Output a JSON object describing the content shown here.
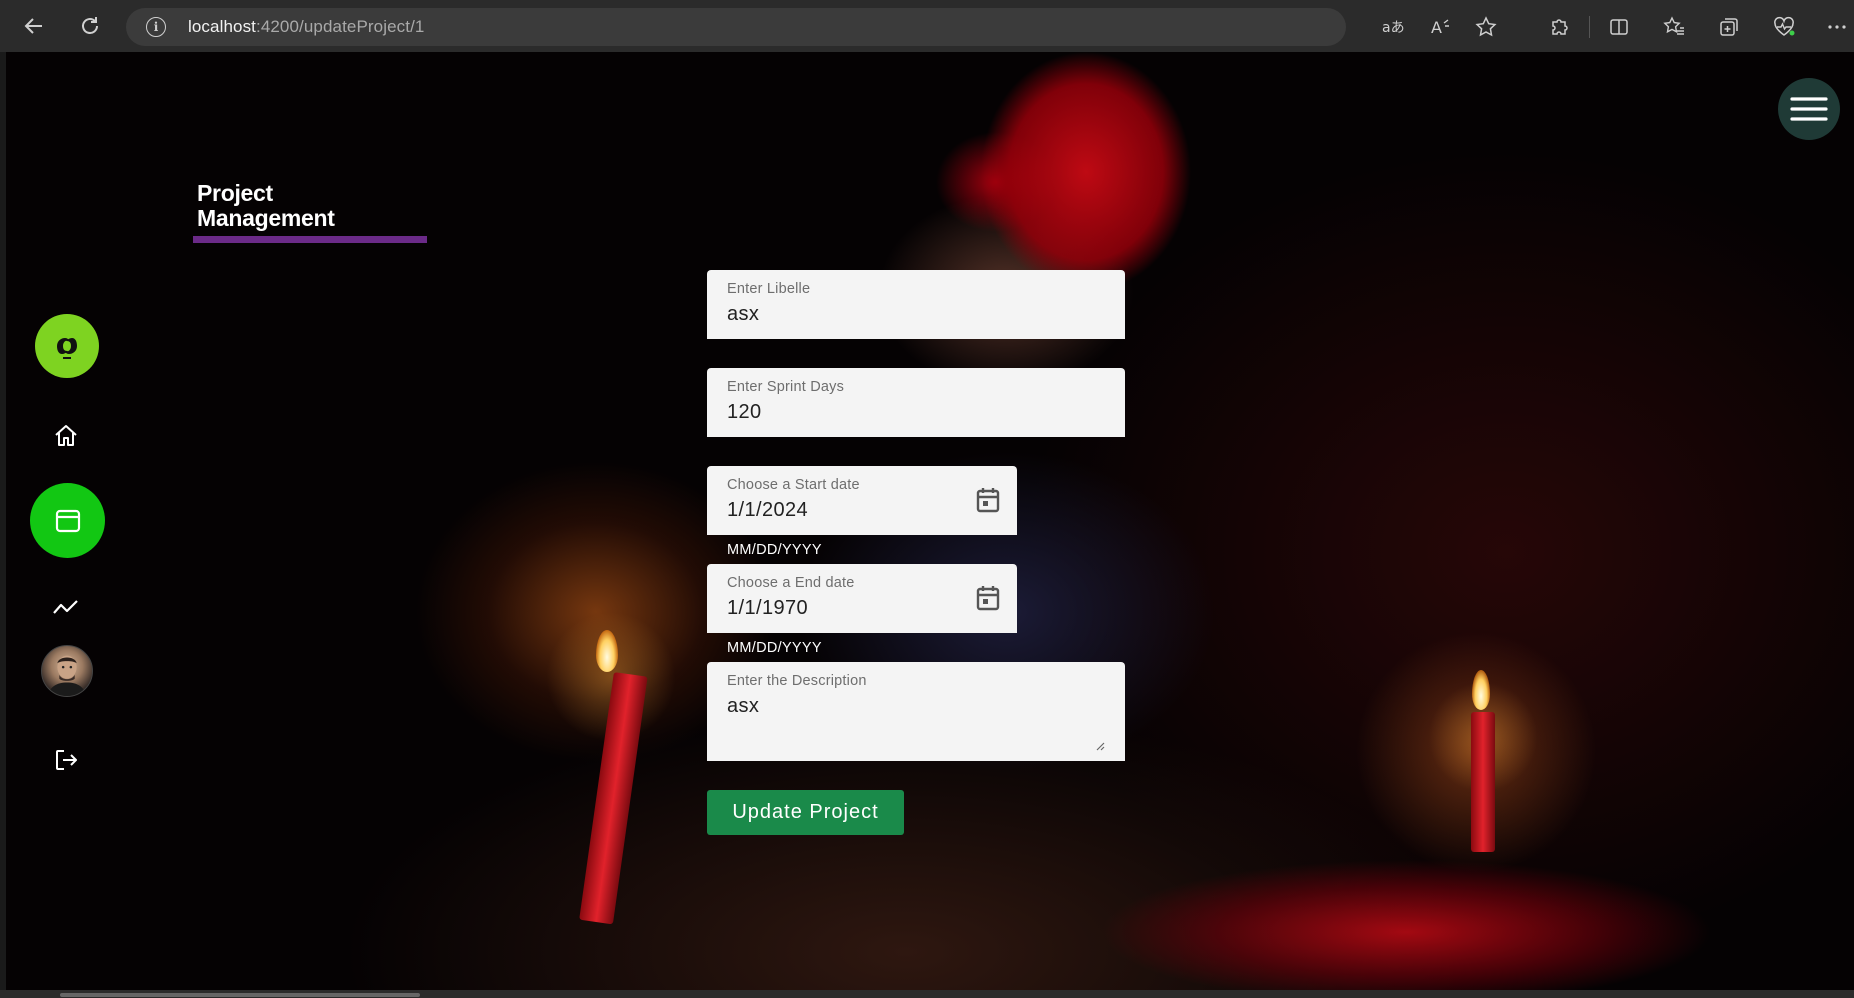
{
  "browser": {
    "url_host": "localhost",
    "url_path": ":4200/updateProject/1"
  },
  "app": {
    "brand_line1": "Project",
    "brand_line2": "Management",
    "accent_color": "#6b2a88",
    "active_color": "#12c713"
  },
  "sidebar": {
    "items": [
      {
        "icon": "logo-icon"
      },
      {
        "icon": "home-icon"
      },
      {
        "icon": "calendar-window-icon",
        "active": true
      },
      {
        "icon": "trend-line-icon"
      },
      {
        "icon": "user-avatar"
      },
      {
        "icon": "logout-icon"
      }
    ]
  },
  "form": {
    "libelle": {
      "label": "Enter Libelle",
      "value": "asx"
    },
    "sprint_days": {
      "label": "Enter Sprint Days",
      "value": "120"
    },
    "start_date": {
      "label": "Choose a Start date",
      "value": "1/1/2024",
      "hint": "MM/DD/YYYY"
    },
    "end_date": {
      "label": "Choose a End date",
      "value": "1/1/1970",
      "hint": "MM/DD/YYYY"
    },
    "description": {
      "label": "Enter the Description",
      "value": "asx"
    },
    "submit_label": "Update Project",
    "submit_color": "#1a8a4a"
  }
}
